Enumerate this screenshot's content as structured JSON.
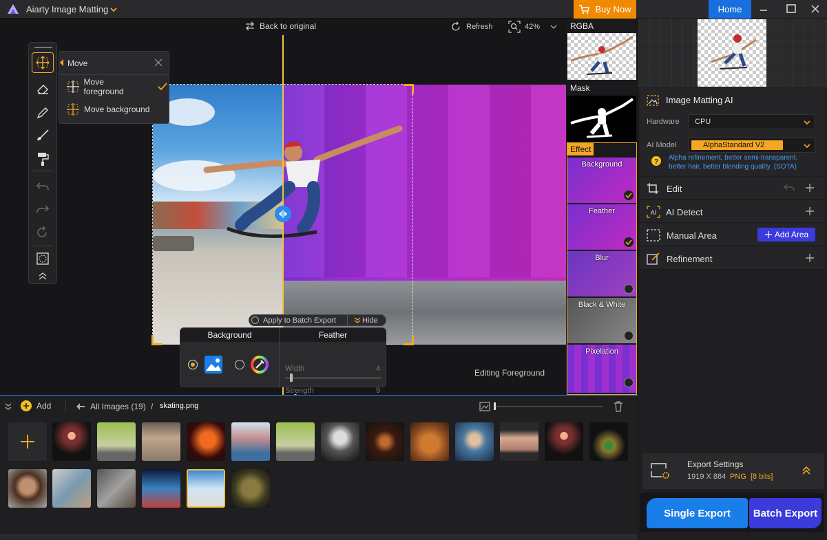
{
  "app": {
    "title": "Aiarty Image Matting",
    "buy_now": "Buy Now",
    "home": "Home"
  },
  "canvas": {
    "back_to_original": "Back to original",
    "refresh": "Refresh",
    "zoom": "42%",
    "status": "Editing Foreground",
    "apply_batch": "Apply to Batch Export",
    "hide": "Hide"
  },
  "move_popup": {
    "title": "Move",
    "foreground": "Move foreground",
    "background": "Move background"
  },
  "bg_panel": {
    "background_tab": "Background",
    "feather_tab": "Feather",
    "width_label": "Width",
    "width_value": "4",
    "strength_label": "Strength",
    "strength_value": "9"
  },
  "preview": {
    "rgba": "RGBA",
    "mask": "Mask",
    "effect": "Effect",
    "effects": [
      {
        "label": "Background",
        "checked": true
      },
      {
        "label": "Feather",
        "checked": true
      },
      {
        "label": "Blur",
        "checked": false
      },
      {
        "label": "Black & White",
        "checked": false
      },
      {
        "label": "Pixelation",
        "checked": false
      }
    ]
  },
  "right_panel": {
    "matting_title": "Image Matting AI",
    "hardware_label": "Hardware",
    "hardware_value": "CPU",
    "model_label": "AI Model",
    "model_value": "AlphaStandard  V2",
    "model_desc": "Alpha refinement, better semi-transparent, better hair, better blending quality. (SOTA)",
    "edit": "Edit",
    "ai_detect": "AI Detect",
    "manual_area": "Manual Area",
    "add_area": "Add Area",
    "refinement": "Refinement",
    "export_settings": "Export Settings",
    "export_size": "1919 X 884",
    "export_format": "PNG",
    "export_bits": "[8 bits]",
    "single_export": "Single Export",
    "batch_export": "Batch Export"
  },
  "gallery": {
    "add": "Add",
    "all_images": "All Images (19)",
    "separator": "/",
    "current_file": "skating.png"
  },
  "colors": {
    "accent": "#f5a623",
    "buy": "#f08a00",
    "blue": "#1a6fe0",
    "purple": "#3b3bdc"
  }
}
